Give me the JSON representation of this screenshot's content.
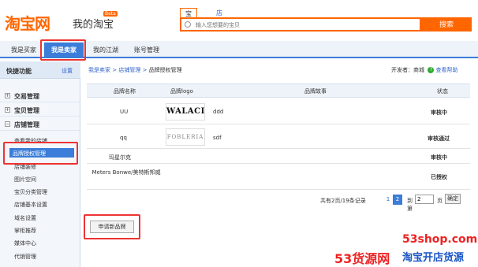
{
  "header": {
    "logo": "淘宝网",
    "my_taobao": "我的淘宝",
    "beta": "Beta",
    "search_tabs": [
      "宝贝",
      "店铺"
    ],
    "search_placeholder": "输入您想要的宝贝",
    "search_button": "搜索"
  },
  "nav": {
    "items": [
      "我是买家",
      "我是卖家",
      "我的江湖",
      "账号管理"
    ]
  },
  "sidebar": {
    "title": "快捷功能",
    "setting": "设置",
    "groups": [
      "交易管理",
      "宝贝管理",
      "店铺管理"
    ],
    "items": [
      "查看我的店铺",
      "品牌授权管理",
      "店铺装修",
      "图片空间",
      "宝贝分类管理",
      "店铺基本设置",
      "域名设置",
      "掌柜推荐",
      "媒体中心",
      "代销管理"
    ]
  },
  "breadcrumb": {
    "items": [
      "我是卖家",
      "店铺管理",
      "品牌授权管理"
    ],
    "separator": ">"
  },
  "developer": {
    "label": "开发者：",
    "value": "商城",
    "help": "查看帮助"
  },
  "table": {
    "headers": [
      "品牌名称",
      "品牌logo",
      "品牌故事",
      "状态"
    ],
    "rows": [
      {
        "name": "UU",
        "logo": "WALACI",
        "story": "ddd",
        "status": "审核中"
      },
      {
        "name": "qq",
        "logo": "FOBLERIA",
        "story": "sdf",
        "status": "审核通过"
      },
      {
        "name": "玛星尔克",
        "logo": "",
        "story": "",
        "status": "审核中"
      },
      {
        "name": "Meters Bonwe/美特斯邦威",
        "logo": "",
        "story": "",
        "status": "已授权"
      }
    ]
  },
  "pager": {
    "summary": "共有2页/19条记录",
    "pages": [
      "1",
      "2"
    ],
    "goto": "到第",
    "value": "2",
    "unit": "页",
    "confirm": "确定"
  },
  "apply_button": "申请新品牌",
  "watermark": {
    "url": "53shop.com",
    "brand": "53货源网",
    "slogan": "淘宝开店货源"
  },
  "colors": {
    "accent": "#ff6600",
    "nav_blue": "#3b7dd8",
    "highlight_red": "#ee3333"
  }
}
